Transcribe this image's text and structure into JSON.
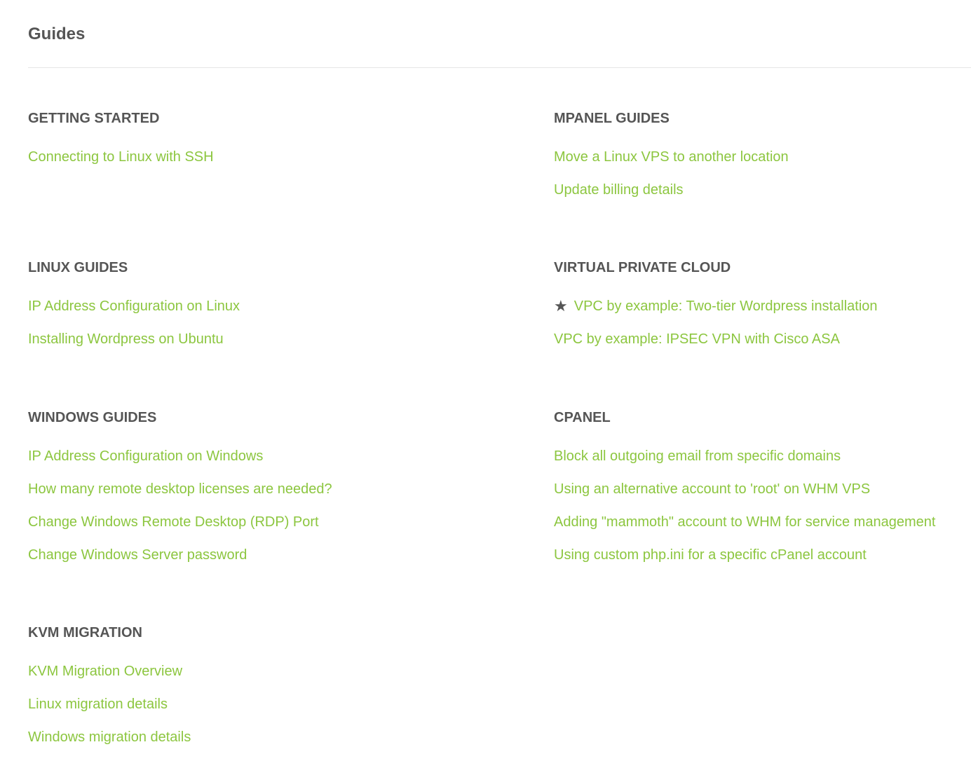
{
  "page": {
    "title": "Guides"
  },
  "colors": {
    "link": "#8cc63f",
    "heading": "#555555",
    "divider": "#e6e6e6"
  },
  "sections": {
    "getting_started": {
      "heading": "GETTING STARTED",
      "links": [
        "Connecting to Linux with SSH"
      ]
    },
    "mpanel_guides": {
      "heading": "MPANEL GUIDES",
      "links": [
        "Move a Linux VPS to another location",
        "Update billing details"
      ]
    },
    "linux_guides": {
      "heading": "LINUX GUIDES",
      "links": [
        "IP Address Configuration on Linux",
        "Installing Wordpress on Ubuntu"
      ]
    },
    "virtual_private_cloud": {
      "heading": "VIRTUAL PRIVATE CLOUD",
      "featured_icon": "star-icon",
      "featured_glyph": "★",
      "links": [
        "VPC by example: Two-tier Wordpress installation",
        "VPC by example: IPSEC VPN with Cisco ASA"
      ]
    },
    "windows_guides": {
      "heading": "WINDOWS GUIDES",
      "links": [
        "IP Address Configuration on Windows",
        "How many remote desktop licenses are needed?",
        "Change Windows Remote Desktop (RDP) Port",
        "Change Windows Server password"
      ]
    },
    "cpanel": {
      "heading": "CPANEL",
      "links": [
        "Block all outgoing email from specific domains",
        "Using an alternative account to 'root' on WHM VPS",
        "Adding \"mammoth\" account to WHM for service management",
        "Using custom php.ini for a specific cPanel account"
      ]
    },
    "kvm_migration": {
      "heading": "KVM MIGRATION",
      "links": [
        "KVM Migration Overview",
        "Linux migration details",
        "Windows migration details"
      ]
    }
  }
}
